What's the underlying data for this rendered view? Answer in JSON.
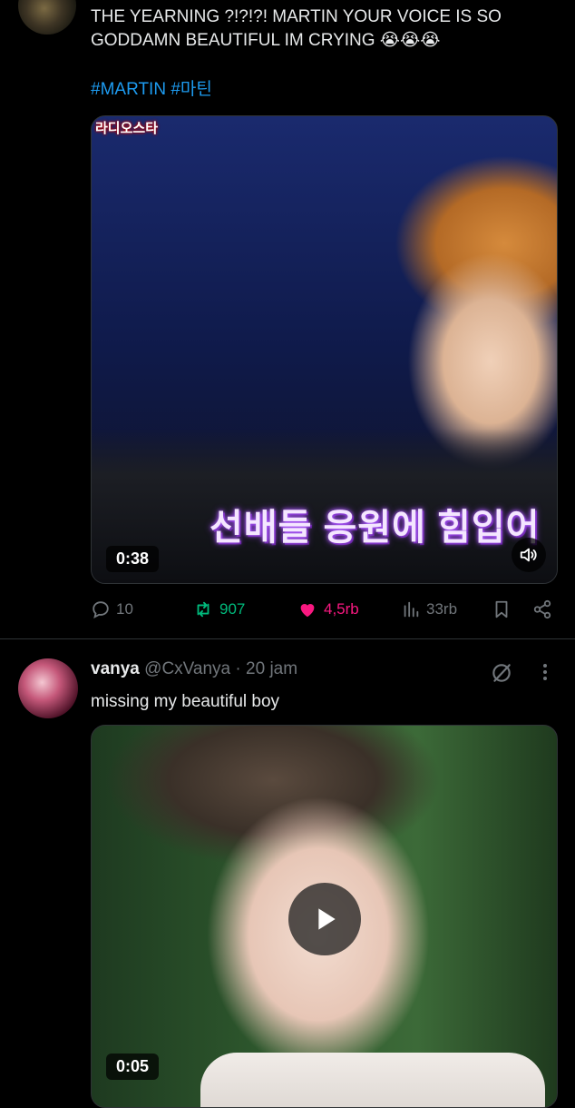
{
  "tweet1": {
    "text": "THE YEARNING ?!?!?! MARTIN YOUR VOICE IS SO GODDAMN BEAUTIFUL IM CRYING 😭😭😭",
    "hashtags": "#MARTIN #마틴",
    "media": {
      "logo_text": "라디오스타",
      "caption_overlay": "선배들 응원에 힘입어",
      "duration": "0:38"
    },
    "actions": {
      "replies": "10",
      "retweets": "907",
      "likes": "4,5rb",
      "views": "33rb"
    }
  },
  "tweet2": {
    "display_name": "vanya",
    "handle": "@CxVanya",
    "time": "· 20 jam",
    "text": "missing my beautiful boy",
    "media": {
      "duration": "0:05"
    }
  },
  "colors": {
    "background": "#000000",
    "link": "#1d9bf0",
    "retweet": "#00ba7c",
    "like": "#f91880",
    "muted": "#71767b"
  }
}
